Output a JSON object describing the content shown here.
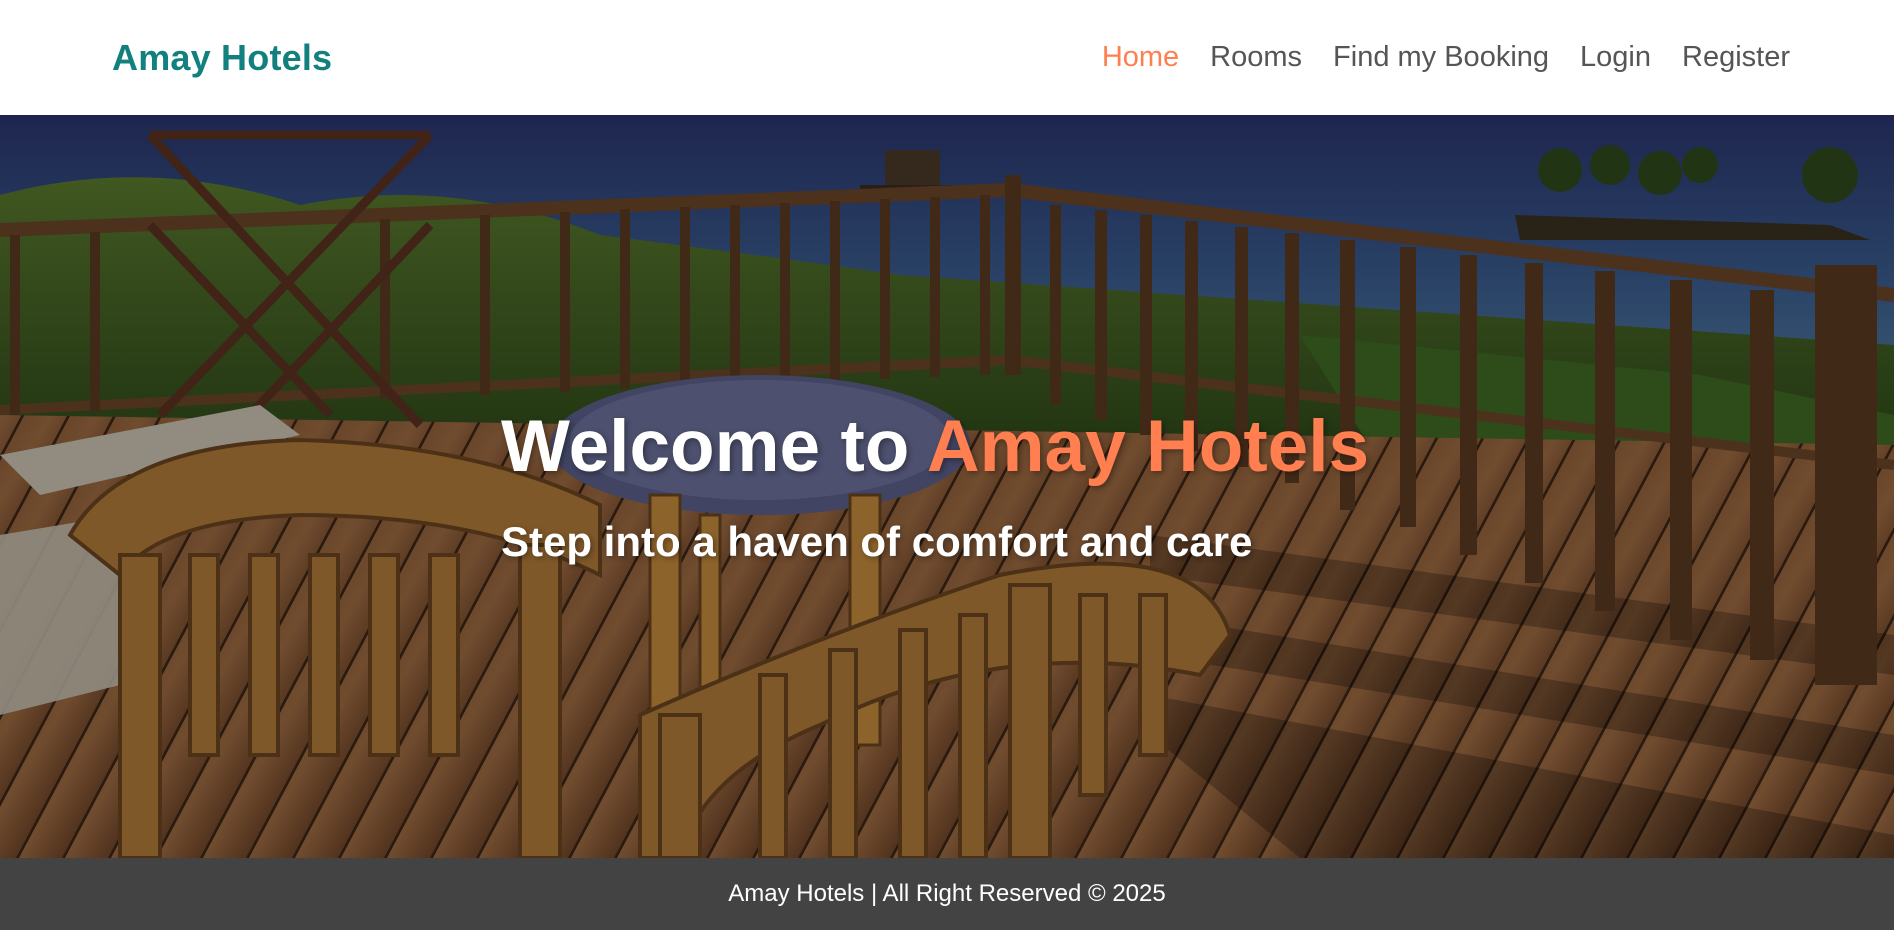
{
  "navbar": {
    "brand": "Amay Hotels",
    "links": [
      {
        "label": "Home",
        "active": true
      },
      {
        "label": "Rooms",
        "active": false
      },
      {
        "label": "Find my Booking",
        "active": false
      },
      {
        "label": "Login",
        "active": false
      },
      {
        "label": "Register",
        "active": false
      }
    ]
  },
  "hero": {
    "title_prefix": "Welcome to",
    "title_accent": "Amay Hotels",
    "subtitle": "Step into a haven of comfort and care",
    "background": "photo of wooden deck with bamboo chairs overlooking the sea"
  },
  "footer": {
    "text": "Amay Hotels | All Right Reserved © 2025"
  },
  "colors": {
    "brand": "#12807f",
    "accent": "#ff7f50",
    "nav_text": "#555555",
    "footer_bg": "#434343"
  }
}
